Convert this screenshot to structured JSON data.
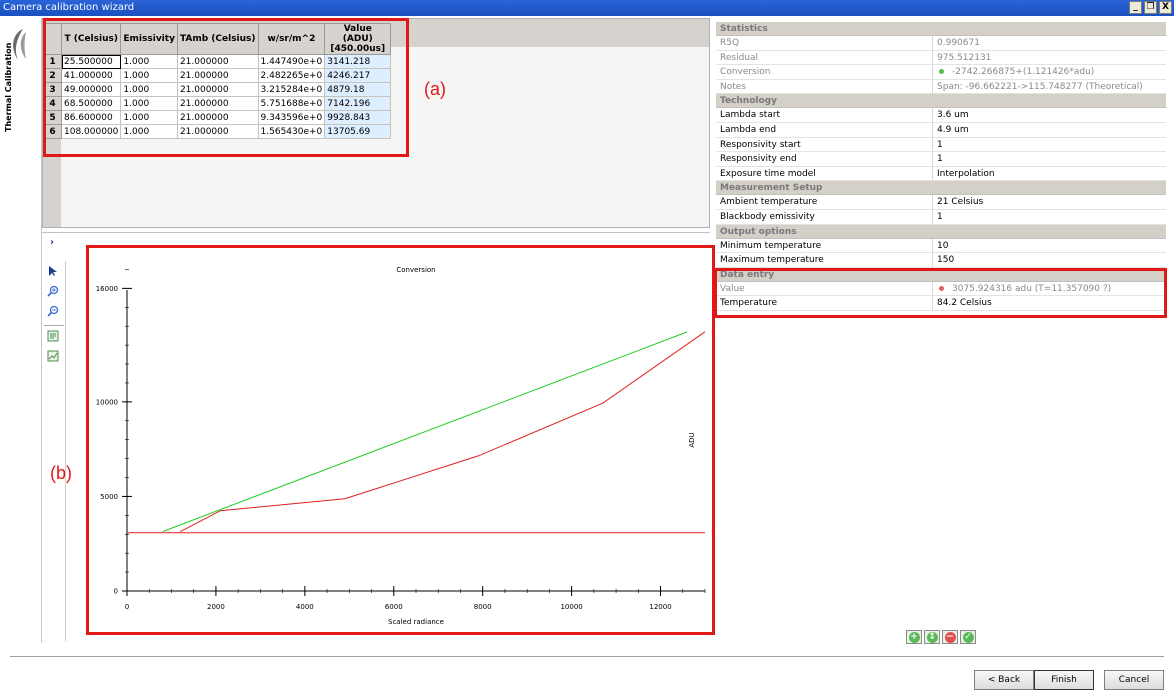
{
  "window": {
    "title": "Camera calibration wizard",
    "buttons": [
      "_",
      "❐",
      "X"
    ]
  },
  "sidebar": {
    "label": "Thermal Calibration"
  },
  "table": {
    "headers": [
      "T (Celsius)",
      "Emissivity",
      "TAmb (Celsius)",
      "w/sr/m^2",
      "Value (ADU)\n[450.00us]"
    ],
    "rows": [
      [
        "1",
        "25.500000",
        "1.000",
        "21.000000",
        "1.447490e+0",
        "3141.218"
      ],
      [
        "2",
        "41.000000",
        "1.000",
        "21.000000",
        "2.482265e+0",
        "4246.217"
      ],
      [
        "3",
        "49.000000",
        "1.000",
        "21.000000",
        "3.215284e+0",
        "4879.18"
      ],
      [
        "4",
        "68.500000",
        "1.000",
        "21.000000",
        "5.751688e+0",
        "7142.196"
      ],
      [
        "5",
        "86.600000",
        "1.000",
        "21.000000",
        "9.343596e+0",
        "9928.843"
      ],
      [
        "6",
        "108.000000",
        "1.000",
        "21.000000",
        "1.565430e+0",
        "13705.69"
      ]
    ]
  },
  "annotations": {
    "a": "(a)",
    "b": "(b)"
  },
  "chart_data": {
    "type": "line",
    "title": "Conversion",
    "xlabel": "Scaled radiance",
    "ylabel": "ADU",
    "xlim": [
      0,
      13000
    ],
    "ylim": [
      0,
      17500
    ],
    "xticks": [
      0,
      2000,
      4000,
      6000,
      8000,
      10000,
      12000
    ],
    "yticks": [
      0,
      5000,
      10000,
      16000
    ],
    "series": [
      {
        "color": "#e02020",
        "x": [
          1200,
          2100,
          4900,
          7900,
          10700,
          13000
        ],
        "y": [
          3141,
          4246,
          4879,
          7142,
          9928,
          13705
        ]
      },
      {
        "color": "#22cc22",
        "x": [
          800,
          12600
        ],
        "y": [
          3140,
          13700
        ]
      },
      {
        "color": "#e02020",
        "x": [
          0,
          13000
        ],
        "y": [
          3075,
          3075
        ]
      }
    ]
  },
  "properties": {
    "sections": [
      {
        "title": "Statistics",
        "rows": [
          {
            "k": "R5Q",
            "v": "0.990671",
            "ro": true
          },
          {
            "k": "Residual",
            "v": "975.512131",
            "ro": true
          },
          {
            "k": "Conversion",
            "v": "-2742.266875+(1.121426*adu)",
            "ro": true,
            "dot": "#55bb55"
          },
          {
            "k": "Notes",
            "v": "Span: -96.662221->115.748277 (Theoretical)",
            "ro": true
          }
        ]
      },
      {
        "title": "Technology",
        "rows": [
          {
            "k": "Lambda start",
            "v": "3.6 um"
          },
          {
            "k": "Lambda end",
            "v": "4.9 um"
          },
          {
            "k": "Responsivity start",
            "v": "1"
          },
          {
            "k": "Responsivity end",
            "v": "1"
          },
          {
            "k": "Exposure time model",
            "v": "Interpolation"
          }
        ]
      },
      {
        "title": "Measurement Setup",
        "rows": [
          {
            "k": "Ambient temperature",
            "v": "21 Celsius"
          },
          {
            "k": "Blackbody emissivity",
            "v": "1"
          }
        ]
      },
      {
        "title": "Output options",
        "rows": [
          {
            "k": "Minimum temperature",
            "v": "10"
          },
          {
            "k": "Maximum temperature",
            "v": "150"
          }
        ]
      },
      {
        "title": "Data entry",
        "rows": [
          {
            "k": "Value",
            "v": "3075.924316 adu (T=11.357090 ?)",
            "ro": true,
            "dot": "#e06060"
          },
          {
            "k": "Temperature",
            "v": "84.2 Celsius"
          }
        ]
      }
    ]
  },
  "nav": {
    "back": "< Back",
    "finish": "Finish",
    "cancel": "Cancel"
  },
  "icons": [
    "logo-icon",
    "collapse-arrow-icon",
    "pointer-icon",
    "zoom-in-icon",
    "zoom-out-icon",
    "export-image-icon",
    "export-data-icon",
    "add-icon",
    "move-icon",
    "remove-icon",
    "check-icon"
  ]
}
